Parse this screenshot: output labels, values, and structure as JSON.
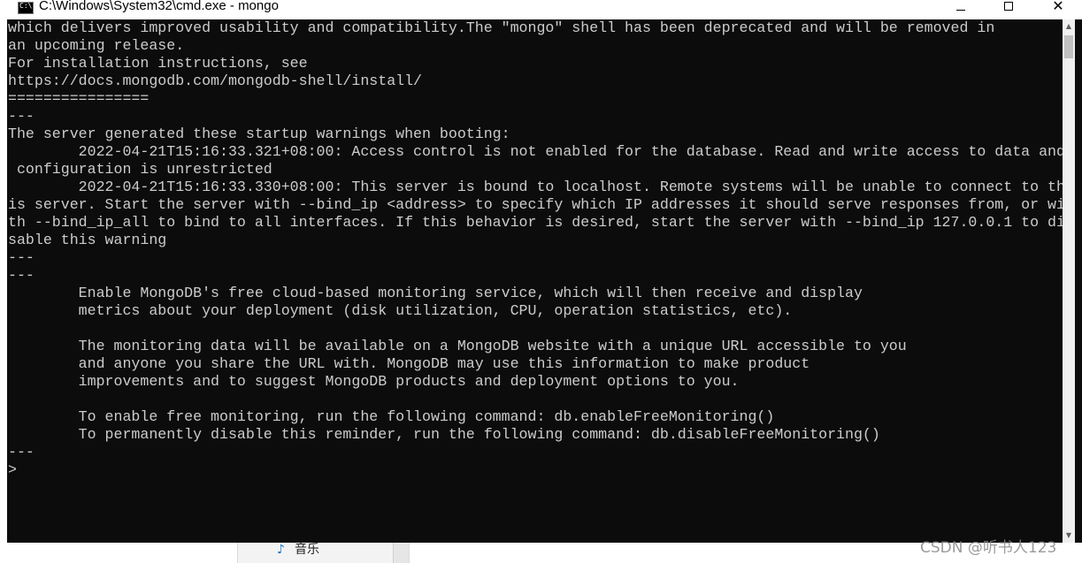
{
  "window": {
    "title": "C:\\Windows\\System32\\cmd.exe - mongo",
    "icon": "cmd-icon",
    "icon_glyph": "C:\\."
  },
  "console": {
    "background": "#0c0c0c",
    "foreground": "#cccccc",
    "lines": [
      "which delivers improved usability and compatibility.The \"mongo\" shell has been deprecated and will be removed in",
      "an upcoming release.",
      "For installation instructions, see",
      "https://docs.mongodb.com/mongodb-shell/install/",
      "================",
      "---",
      "The server generated these startup warnings when booting:",
      "        2022-04-21T15:16:33.321+08:00: Access control is not enabled for the database. Read and write access to data and",
      " configuration is unrestricted",
      "        2022-04-21T15:16:33.330+08:00: This server is bound to localhost. Remote systems will be unable to connect to th",
      "is server. Start the server with --bind_ip <address> to specify which IP addresses it should serve responses from, or wi",
      "th --bind_ip_all to bind to all interfaces. If this behavior is desired, start the server with --bind_ip 127.0.0.1 to di",
      "sable this warning",
      "---",
      "---",
      "        Enable MongoDB's free cloud-based monitoring service, which will then receive and display",
      "        metrics about your deployment (disk utilization, CPU, operation statistics, etc).",
      "",
      "        The monitoring data will be available on a MongoDB website with a unique URL accessible to you",
      "        and anyone you share the URL with. MongoDB may use this information to make product",
      "        improvements and to suggest MongoDB products and deployment options to you.",
      "",
      "        To enable free monitoring, run the following command: db.enableFreeMonitoring()",
      "        To permanently disable this reminder, run the following command: db.disableFreeMonitoring()",
      "---",
      ">"
    ]
  },
  "background_app": {
    "item_icon": "music-note-icon",
    "item_icon_glyph": "♪",
    "item_label": "音乐"
  },
  "watermark": "CSDN @听书人123"
}
